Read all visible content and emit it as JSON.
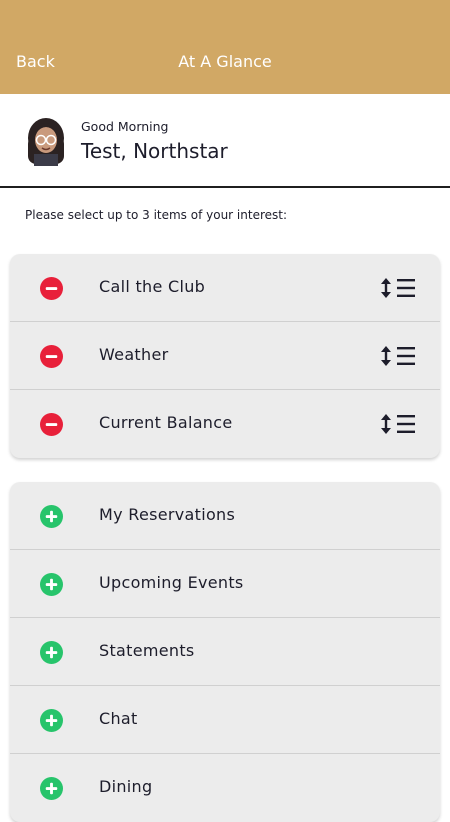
{
  "header": {
    "back_label": "Back",
    "title": "At A Glance",
    "background": "#d1a865"
  },
  "profile": {
    "greeting": "Good Morning",
    "name": "Test, Northstar"
  },
  "prompt": "Please select up to 3 items of your interest:",
  "selected_items": [
    {
      "label": "Call the Club",
      "action_icon": "remove-icon",
      "handle_icon": "reorder-icon"
    },
    {
      "label": "Weather",
      "action_icon": "remove-icon",
      "handle_icon": "reorder-icon"
    },
    {
      "label": "Current Balance",
      "action_icon": "remove-icon",
      "handle_icon": "reorder-icon"
    }
  ],
  "available_items": [
    {
      "label": "My Reservations",
      "action_icon": "add-icon"
    },
    {
      "label": "Upcoming Events",
      "action_icon": "add-icon"
    },
    {
      "label": "Statements",
      "action_icon": "add-icon"
    },
    {
      "label": "Chat",
      "action_icon": "add-icon"
    },
    {
      "label": "Dining",
      "action_icon": "add-icon"
    }
  ],
  "colors": {
    "remove": "#e8203a",
    "add": "#27c46b",
    "card": "#ececec"
  }
}
